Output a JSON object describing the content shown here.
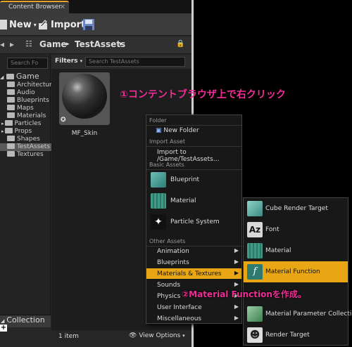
{
  "tab": {
    "title": "Content Browser"
  },
  "toolbar": {
    "new_label": "New",
    "import_label": "Import"
  },
  "path": {
    "root": "Game",
    "folder": "TestAssets"
  },
  "tree": {
    "search_placeholder": "Search Fo",
    "root": "Game",
    "items": [
      "Architectur",
      "Audio",
      "Blueprints",
      "Maps",
      "Materials",
      "Particles",
      "Props",
      "Shapes",
      "TestAssets",
      "Textures"
    ]
  },
  "assets": {
    "filters_label": "Filters",
    "search_placeholder": "Search TestAssets",
    "asset_name": "MF_Skin",
    "item_count": "1 item",
    "view_options": "View Options"
  },
  "collections": {
    "label": "Collection"
  },
  "context_menu": {
    "folder_header": "Folder",
    "new_folder": "New Folder",
    "import_header": "Import Asset",
    "import_to": "Import to /Game/TestAssets...",
    "basic_header": "Basic Assets",
    "blueprint": "Blueprint",
    "material": "Material",
    "particle_system": "Particle System",
    "other_header": "Other Assets",
    "other_items": [
      "Animation",
      "Blueprints",
      "Materials & Textures",
      "Sounds",
      "Physics",
      "User Interface",
      "Miscellaneous"
    ]
  },
  "submenu": {
    "items": [
      "Cube Render Target",
      "Font",
      "Material",
      "Material Function",
      "Material Parameter Collection",
      "Render Target"
    ]
  },
  "annotations": {
    "step1": "①コンテントブラウザ上で右クリック",
    "step2": "②Material Functionを作成。"
  },
  "colors": {
    "accent": "#e8a614",
    "annotation": "#f02c96",
    "tab_accent": "#e8a32a"
  }
}
